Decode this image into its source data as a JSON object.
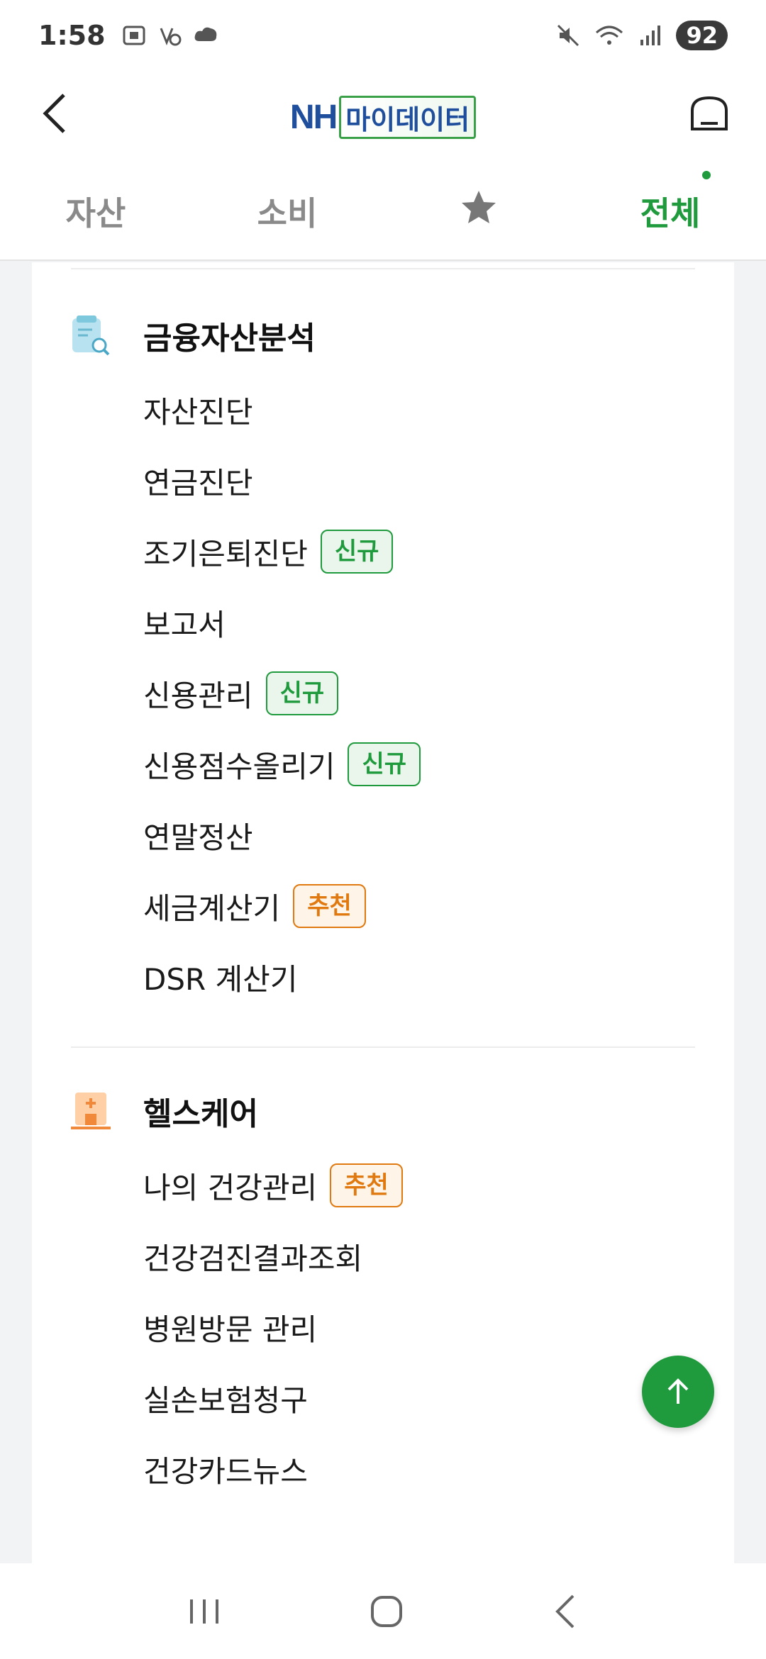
{
  "status_bar": {
    "time": "1:58",
    "battery": "92"
  },
  "header": {
    "logo_brand": "NH",
    "logo_text": "마이데이터"
  },
  "tabs": [
    {
      "label": "자산"
    },
    {
      "label": "소비"
    },
    {
      "label": "",
      "icon": "star-icon"
    },
    {
      "label": "전체",
      "active": true
    }
  ],
  "sections": [
    {
      "title": "금융자산분석",
      "icon": "financial-analysis-icon",
      "items": [
        {
          "label": "자산진단"
        },
        {
          "label": "연금진단"
        },
        {
          "label": "조기은퇴진단",
          "badge": "신규"
        },
        {
          "label": "보고서"
        },
        {
          "label": "신용관리",
          "badge": "신규"
        },
        {
          "label": "신용점수올리기",
          "badge": "신규"
        },
        {
          "label": "연말정산"
        },
        {
          "label": "세금계산기",
          "badge": "추천"
        },
        {
          "label": "DSR 계산기"
        }
      ]
    },
    {
      "title": "헬스케어",
      "icon": "hospital-icon",
      "items": [
        {
          "label": "나의 건강관리",
          "badge": "추천"
        },
        {
          "label": "건강검진결과조회"
        },
        {
          "label": "병원방문 관리"
        },
        {
          "label": "실손보험청구"
        },
        {
          "label": "건강카드뉴스"
        }
      ]
    }
  ],
  "colors": {
    "accent_green": "#1f9a3c",
    "badge_orange": "#e07a10",
    "brand_blue": "#1e4e9c"
  }
}
